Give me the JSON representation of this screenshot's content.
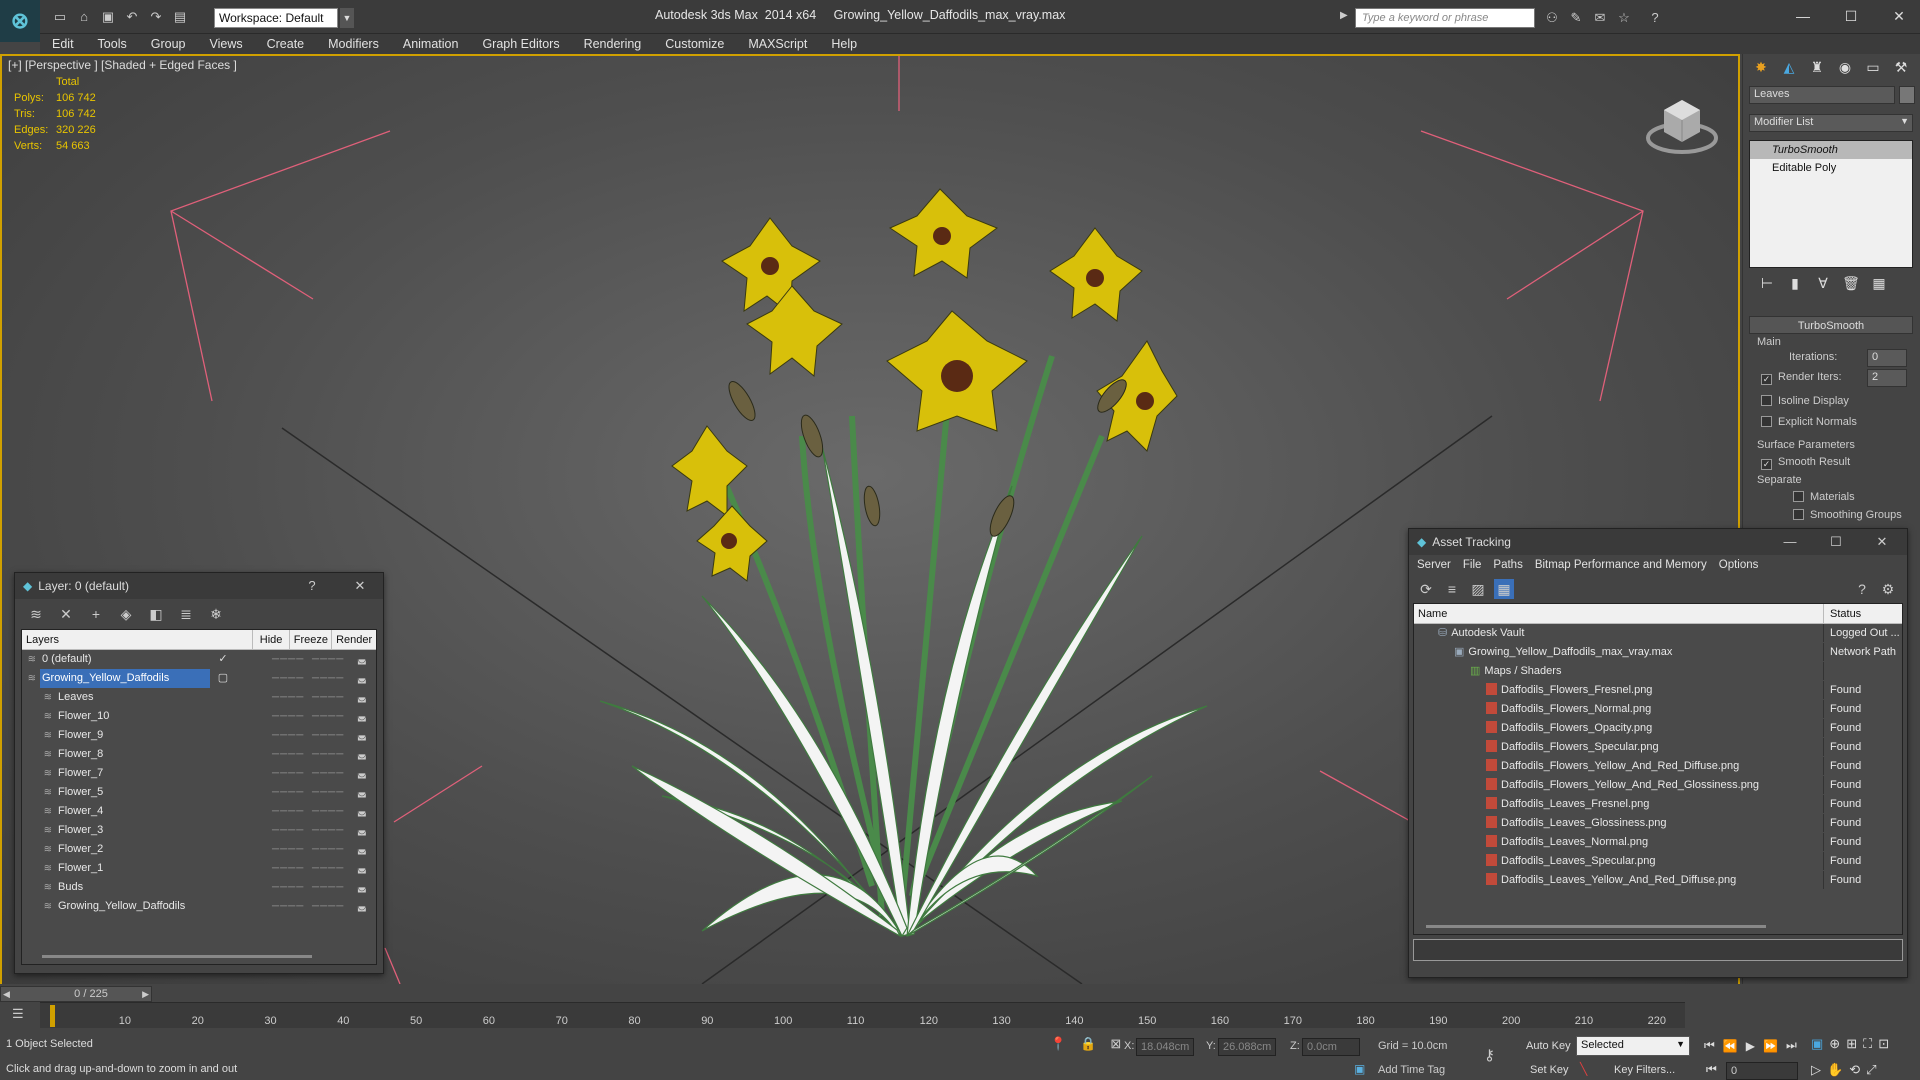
{
  "titlebar": {
    "workspace": "Workspace: Default",
    "title": "Autodesk 3ds Max  2014 x64     Growing_Yellow_Daffodils_max_vray.max",
    "search_placeholder": "Type a keyword or phrase"
  },
  "menu": [
    "Edit",
    "Tools",
    "Group",
    "Views",
    "Create",
    "Modifiers",
    "Animation",
    "Graph Editors",
    "Rendering",
    "Customize",
    "MAXScript",
    "Help"
  ],
  "viewport": {
    "label": "[+] [Perspective ] [Shaded + Edged Faces ]",
    "stats_header": "Total",
    "stats": [
      {
        "label": "Polys:",
        "value": "106 742"
      },
      {
        "label": "Tris:",
        "value": "106 742"
      },
      {
        "label": "Edges:",
        "value": "320 226"
      },
      {
        "label": "Verts:",
        "value": "54 663"
      }
    ]
  },
  "command_panel": {
    "object_name": "Leaves",
    "modifier_list": "Modifier List",
    "stack": [
      {
        "label": "TurboSmooth",
        "selected": true
      },
      {
        "label": "Editable Poly",
        "selected": false
      }
    ],
    "rollout_title": "TurboSmooth",
    "main_label": "Main",
    "iterations_label": "Iterations:",
    "iterations_value": "0",
    "render_iters_label": "Render Iters:",
    "render_iters_value": "2",
    "isoline_label": "Isoline Display",
    "explicit_normals_label": "Explicit Normals",
    "surface_params_label": "Surface Parameters",
    "smooth_result_label": "Smooth Result",
    "separate_label": "Separate",
    "materials_label": "Materials",
    "smoothing_groups_label": "Smoothing Groups"
  },
  "layer_dialog": {
    "title": "Layer: 0 (default)",
    "help": "?",
    "headers": {
      "layers": "Layers",
      "hide": "Hide",
      "freeze": "Freeze",
      "render": "Render"
    },
    "rows": [
      {
        "name": "0 (default)",
        "indent": 1,
        "selected": false,
        "active": true
      },
      {
        "name": "Growing_Yellow_Daffodils",
        "indent": 1,
        "selected": true,
        "active": false
      },
      {
        "name": "Leaves",
        "indent": 2,
        "selected": false,
        "active": false
      },
      {
        "name": "Flower_10",
        "indent": 2,
        "selected": false,
        "active": false
      },
      {
        "name": "Flower_9",
        "indent": 2,
        "selected": false,
        "active": false
      },
      {
        "name": "Flower_8",
        "indent": 2,
        "selected": false,
        "active": false
      },
      {
        "name": "Flower_7",
        "indent": 2,
        "selected": false,
        "active": false
      },
      {
        "name": "Flower_5",
        "indent": 2,
        "selected": false,
        "active": false
      },
      {
        "name": "Flower_4",
        "indent": 2,
        "selected": false,
        "active": false
      },
      {
        "name": "Flower_3",
        "indent": 2,
        "selected": false,
        "active": false
      },
      {
        "name": "Flower_2",
        "indent": 2,
        "selected": false,
        "active": false
      },
      {
        "name": "Flower_1",
        "indent": 2,
        "selected": false,
        "active": false
      },
      {
        "name": "Buds",
        "indent": 2,
        "selected": false,
        "active": false
      },
      {
        "name": "Growing_Yellow_Daffodils",
        "indent": 2,
        "selected": false,
        "active": false
      }
    ]
  },
  "asset_tracking": {
    "title": "Asset Tracking",
    "menu": [
      "Server",
      "File",
      "Paths",
      "Bitmap Performance and Memory",
      "Options"
    ],
    "headers": {
      "name": "Name",
      "status": "Status"
    },
    "rows": [
      {
        "name": "Autodesk Vault",
        "status": "Logged Out ...",
        "indent": 1,
        "icon": "vault"
      },
      {
        "name": "Growing_Yellow_Daffodils_max_vray.max",
        "status": "Network Path",
        "indent": 2,
        "icon": "max"
      },
      {
        "name": "Maps / Shaders",
        "status": "",
        "indent": 3,
        "icon": "folder"
      },
      {
        "name": "Daffodils_Flowers_Fresnel.png",
        "status": "Found",
        "indent": 4,
        "icon": "png"
      },
      {
        "name": "Daffodils_Flowers_Normal.png",
        "status": "Found",
        "indent": 4,
        "icon": "png"
      },
      {
        "name": "Daffodils_Flowers_Opacity.png",
        "status": "Found",
        "indent": 4,
        "icon": "png"
      },
      {
        "name": "Daffodils_Flowers_Specular.png",
        "status": "Found",
        "indent": 4,
        "icon": "png"
      },
      {
        "name": "Daffodils_Flowers_Yellow_And_Red_Diffuse.png",
        "status": "Found",
        "indent": 4,
        "icon": "png"
      },
      {
        "name": "Daffodils_Flowers_Yellow_And_Red_Glossiness.png",
        "status": "Found",
        "indent": 4,
        "icon": "png"
      },
      {
        "name": "Daffodils_Leaves_Fresnel.png",
        "status": "Found",
        "indent": 4,
        "icon": "png"
      },
      {
        "name": "Daffodils_Leaves_Glossiness.png",
        "status": "Found",
        "indent": 4,
        "icon": "png"
      },
      {
        "name": "Daffodils_Leaves_Normal.png",
        "status": "Found",
        "indent": 4,
        "icon": "png"
      },
      {
        "name": "Daffodils_Leaves_Specular.png",
        "status": "Found",
        "indent": 4,
        "icon": "png"
      },
      {
        "name": "Daffodils_Leaves_Yellow_And_Red_Diffuse.png",
        "status": "Found",
        "indent": 4,
        "icon": "png"
      }
    ]
  },
  "timeline": {
    "frame": "0 / 225",
    "ticks": [
      "10",
      "20",
      "30",
      "40",
      "50",
      "60",
      "70",
      "80",
      "90",
      "100",
      "110",
      "120",
      "130",
      "140",
      "150",
      "160",
      "170",
      "180",
      "190",
      "200",
      "210",
      "220"
    ]
  },
  "status": {
    "selection": "1 Object Selected",
    "prompt": "Click and drag up-and-down to zoom in and out",
    "x_label": "X:",
    "x_value": "18.048cm",
    "y_label": "Y:",
    "y_value": "26.088cm",
    "z_label": "Z:",
    "z_value": "0.0cm",
    "grid": "Grid = 10.0cm",
    "add_time_tag": "Add Time Tag",
    "auto_key": "Auto Key",
    "set_key": "Set Key",
    "selected_dropdown": "Selected",
    "key_filters": "Key Filters...",
    "frame_value": "0"
  },
  "colors": {
    "accent": "#d0a000",
    "selection": "#3a6fb8",
    "stats": "#e8c400"
  }
}
